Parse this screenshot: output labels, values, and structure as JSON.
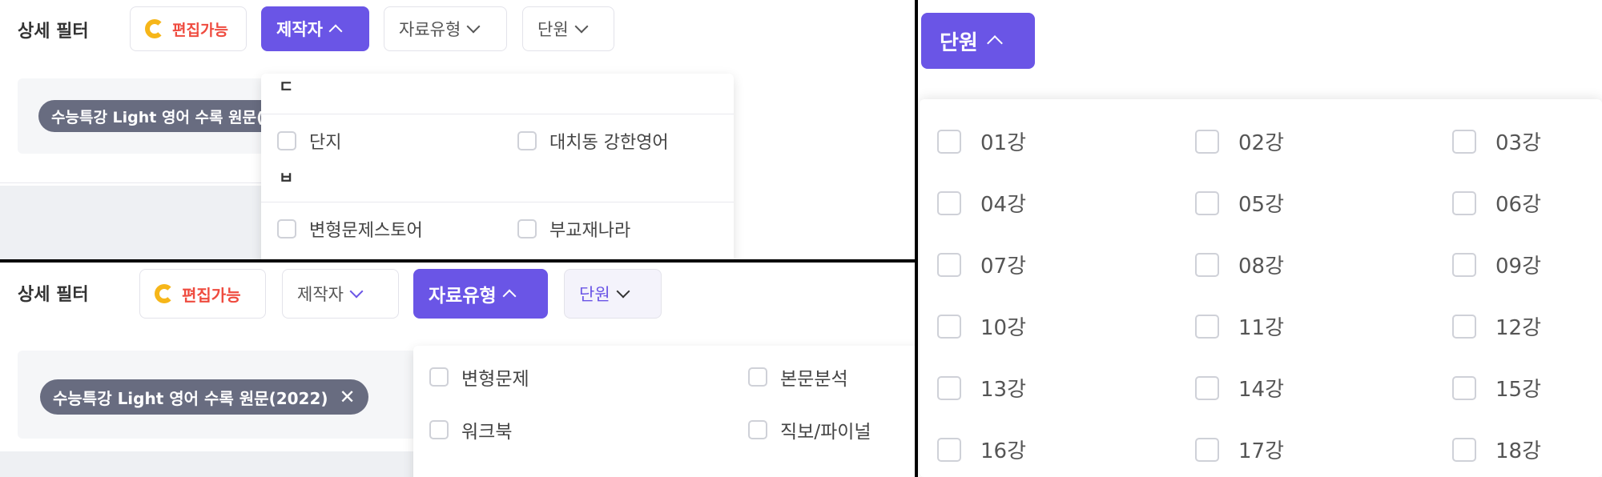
{
  "top_left": {
    "filter_label": "상세 필터",
    "chips": {
      "editable": "편집가능",
      "author": "제작자",
      "type": "자료유형",
      "unit": "단원"
    },
    "tag": "수능특강 Light 영어 수록 원문(",
    "dropdown": {
      "group_1": "ㄷ",
      "group_1_items": [
        "단지",
        "대치동 강한영어"
      ],
      "group_2": "ㅂ",
      "group_2_items": [
        "변형문제스토어",
        "부교재나라"
      ]
    }
  },
  "bottom_left": {
    "filter_label": "상세 필터",
    "chips": {
      "editable": "편집가능",
      "author": "제작자",
      "type": "자료유형",
      "unit": "단원"
    },
    "tag": "수능특강 Light 영어 수록 원문(2022)",
    "tag_close": "✕",
    "dropdown_items": [
      "변형문제",
      "본문분석",
      "워크북",
      "직보/파이널"
    ]
  },
  "right": {
    "chip": "단원",
    "lessons": [
      "01강",
      "02강",
      "03강",
      "04강",
      "05강",
      "06강",
      "07강",
      "08강",
      "09강",
      "10강",
      "11강",
      "12강",
      "13강",
      "14강",
      "15강",
      "16강",
      "17강",
      "18강"
    ]
  },
  "colors": {
    "accent": "#6a55e6",
    "editable": "#ef4b3f",
    "tag_bg": "#686c80",
    "logo": "#f6b619"
  }
}
